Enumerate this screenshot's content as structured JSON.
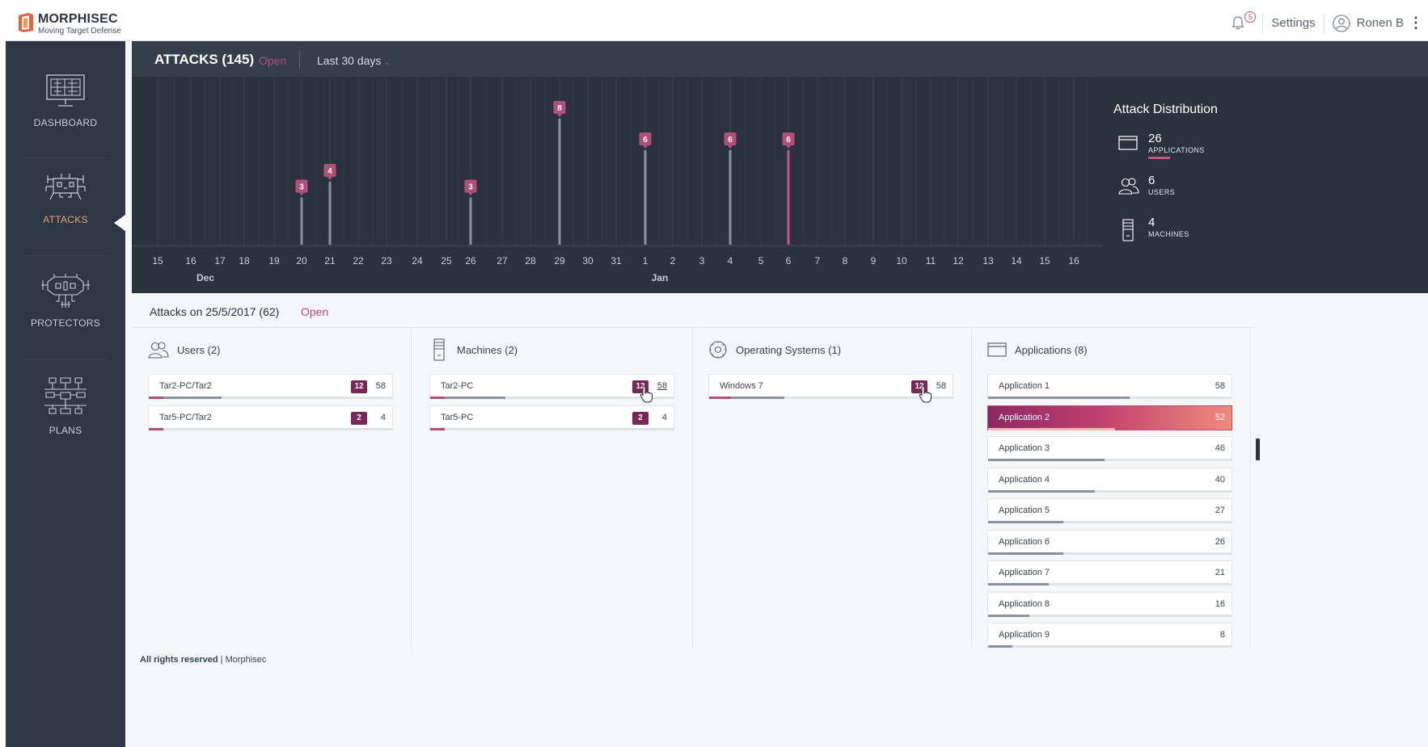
{
  "header": {
    "brand": "MORPHISEC",
    "tagline": "Moving Target Defense",
    "notification_count": "5",
    "settings_label": "Settings",
    "user_name": "Ronen B"
  },
  "sidebar": {
    "items": [
      {
        "label": "DASHBOARD",
        "icon": "monitor-grid-icon"
      },
      {
        "label": "ATTACKS",
        "icon": "invader-icon",
        "active": true
      },
      {
        "label": "PROTECTORS",
        "icon": "shield-circuit-icon"
      },
      {
        "label": "PLANS",
        "icon": "network-grid-icon"
      }
    ]
  },
  "attacks_panel": {
    "title": "ATTACKS (145)",
    "status": "Open",
    "range": "Last 30 days"
  },
  "chart_data": {
    "type": "bar",
    "categories": [
      "15",
      "16",
      "17",
      "18",
      "19",
      "20",
      "21",
      "22",
      "23",
      "24",
      "25",
      "26",
      "27",
      "28",
      "29",
      "30",
      "31",
      "1",
      "2",
      "3",
      "4",
      "5",
      "6",
      "7",
      "8",
      "9",
      "10",
      "11",
      "12",
      "13",
      "14",
      "15",
      "16"
    ],
    "month_labels": [
      {
        "label": "Dec",
        "at": "16"
      },
      {
        "label": "Jan",
        "at": "1"
      }
    ],
    "values": [
      0,
      0,
      0,
      0,
      0,
      3,
      4,
      0,
      0,
      0,
      0,
      3,
      0,
      0,
      8,
      0,
      0,
      6,
      0,
      0,
      6,
      0,
      6,
      0,
      0,
      0,
      0,
      0,
      0,
      0,
      0,
      0,
      0
    ],
    "highlighted_category_index": 22,
    "colors": {
      "bar": "#8b9198",
      "highlight": "#c4547d",
      "label_bg": "#b34e78"
    }
  },
  "distribution": {
    "title": "Attack Distribution",
    "items": [
      {
        "count": "26",
        "label": "APPLICATIONS",
        "icon": "window-icon"
      },
      {
        "count": "6",
        "label": "USERS",
        "icon": "users-icon"
      },
      {
        "count": "4",
        "label": "MACHINES",
        "icon": "server-icon"
      }
    ]
  },
  "detail": {
    "title": "Attacks on 25/5/2017 (62)",
    "status": "Open",
    "columns": [
      {
        "title": "Users (2)",
        "icon": "users-icon",
        "rows": [
          {
            "name": "Tar2-PC/Tar2",
            "badge": "12",
            "count": "58",
            "fill": 0.3,
            "accent": 0.06
          },
          {
            "name": "Tar5-PC/Tar2",
            "badge": "2",
            "count": "4",
            "fill": 0.06,
            "accent": 0.06
          }
        ]
      },
      {
        "title": "Machines (2)",
        "icon": "server-icon",
        "rows": [
          {
            "name": "Tar2-PC",
            "badge": "12",
            "count": "58",
            "fill": 0.31,
            "accent": 0.06
          },
          {
            "name": "Tar5-PC",
            "badge": "2",
            "count": "4",
            "fill": 0.06,
            "accent": 0.06
          }
        ]
      },
      {
        "title": "Operating Systems (1)",
        "icon": "gear-icon",
        "rows": [
          {
            "name": "Windows 7",
            "badge": "12",
            "count": "58",
            "fill": 0.31,
            "accent": 0.09
          }
        ]
      },
      {
        "title": "Applications (8)",
        "icon": "window-icon",
        "rows": [
          {
            "name": "Application 1",
            "count": "58",
            "fill": 0.58
          },
          {
            "name": "Application 2",
            "count": "52",
            "fill": 0.52,
            "highlighted": true
          },
          {
            "name": "Application 3",
            "count": "46",
            "fill": 0.48
          },
          {
            "name": "Application 4",
            "count": "40",
            "fill": 0.44
          },
          {
            "name": "Application 5",
            "count": "27",
            "fill": 0.31
          },
          {
            "name": "Application 6",
            "count": "26",
            "fill": 0.31
          },
          {
            "name": "Application 7",
            "count": "21",
            "fill": 0.25
          },
          {
            "name": "Application 8",
            "count": "16",
            "fill": 0.17
          },
          {
            "name": "Application 9",
            "count": "8",
            "fill": 0.1
          }
        ]
      }
    ]
  },
  "footer": {
    "rights": "All rights reserved",
    "company": "Morphisec"
  }
}
